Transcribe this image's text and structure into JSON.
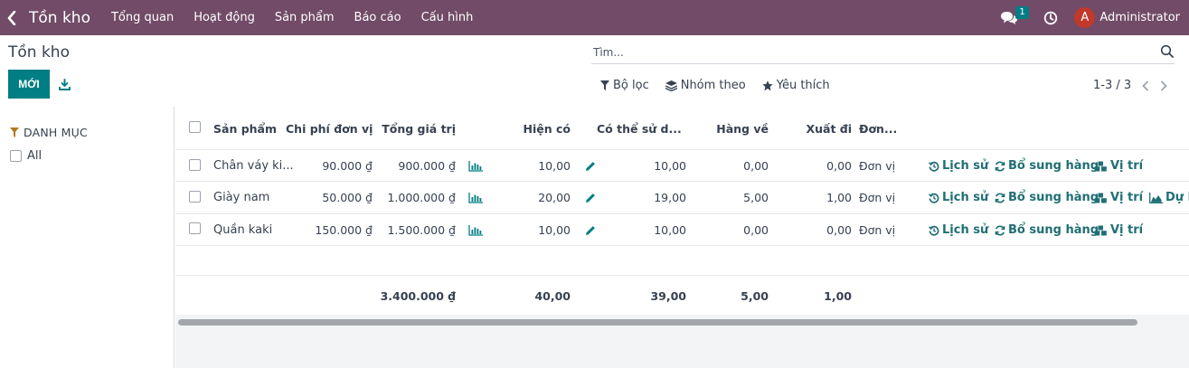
{
  "navbar": {
    "app_title": "Tồn kho",
    "menu": [
      "Tổng quan",
      "Hoạt động",
      "Sản phẩm",
      "Báo cáo",
      "Cấu hình"
    ],
    "chat_count": "1",
    "user_initial": "A",
    "user_name": "Administrator"
  },
  "control": {
    "title": "Tồn kho",
    "new_label": "MỚI",
    "search_placeholder": "Tìm...",
    "filter_label": "Bộ lọc",
    "group_label": "Nhóm theo",
    "fav_label": "Yêu thích",
    "pager": "1-3 / 3"
  },
  "sidepanel": {
    "heading": "DANH MỤC",
    "all_label": "All"
  },
  "table": {
    "headers": {
      "product": "Sản phẩm",
      "unit_cost": "Chi phí đơn vị",
      "total_value": "Tổng giá trị",
      "on_hand": "Hiện có",
      "available": "Có thể sử d...",
      "incoming": "Hàng về",
      "outgoing": "Xuất đi",
      "uom": "Đơn..."
    },
    "rows": [
      {
        "product": "Chân váy ki...",
        "unit_cost": "90.000 ₫",
        "total_value": "900.000 ₫",
        "on_hand": "10,00",
        "available": "10,00",
        "incoming": "0,00",
        "outgoing": "0,00",
        "uom": "Đơn vị"
      },
      {
        "product": "Giày nam",
        "unit_cost": "50.000 ₫",
        "total_value": "1.000.000 ₫",
        "on_hand": "20,00",
        "available": "19,00",
        "incoming": "5,00",
        "outgoing": "1,00",
        "uom": "Đơn vị"
      },
      {
        "product": "Quần kaki",
        "unit_cost": "150.000 ₫",
        "total_value": "1.500.000 ₫",
        "on_hand": "10,00",
        "available": "10,00",
        "incoming": "0,00",
        "outgoing": "0,00",
        "uom": "Đơn vị"
      }
    ],
    "actions": {
      "history": "Lịch sử",
      "replenish": "Bổ sung hàng",
      "locations": "Vị trí",
      "forecast": "Dự b"
    },
    "totals": {
      "total_value": "3.400.000 ₫",
      "on_hand": "40,00",
      "available": "39,00",
      "incoming": "5,00",
      "outgoing": "1,00"
    }
  },
  "colors": {
    "navbar": "#714B67",
    "primary": "#017E84",
    "avatar": "#C0392B"
  }
}
